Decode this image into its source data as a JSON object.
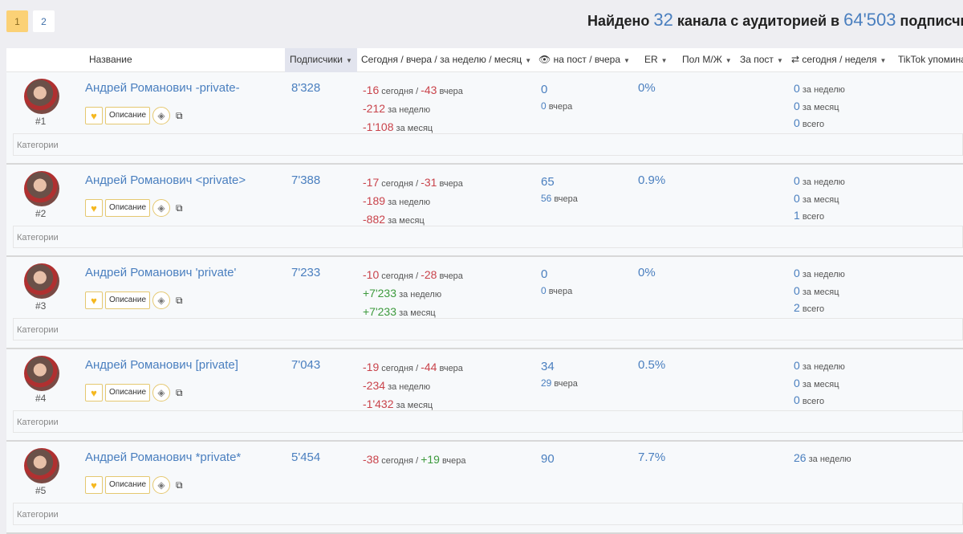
{
  "pagination": {
    "pages": [
      "1",
      "2"
    ],
    "active": "1"
  },
  "summary": {
    "prefix": "Найдено",
    "count": "32",
    "middle": "канала с аудиторией в",
    "audience": "64'503",
    "suffix": "подписчиков"
  },
  "columns": {
    "name": "Название",
    "subscribers": "Подписчики",
    "dynamics": "Сегодня / вчера / за неделю / месяц",
    "views": "на пост / вчера",
    "er": "ER",
    "gender": "Пол М/Ж",
    "per_post": "За пост",
    "reposts": "сегодня / неделя",
    "tiktok": "TikTok упомина"
  },
  "labels": {
    "description": "Описание",
    "categories": "Категории",
    "today": "сегодня /",
    "yesterday": "вчера",
    "week": "за неделю",
    "month": "за месяц",
    "total": "всего"
  },
  "rows": [
    {
      "rank": "#1",
      "name": "Андрей Романович -private-",
      "subs": "8'328",
      "today": "-16",
      "yest": "-43",
      "week": "-212",
      "month": "-1'108",
      "vpost": "0",
      "vyest": "0",
      "er": "0%",
      "r_week": "0",
      "r_month": "0",
      "r_total": "0"
    },
    {
      "rank": "#2",
      "name": "Андрей Романович <private>",
      "subs": "7'388",
      "today": "-17",
      "yest": "-31",
      "week": "-189",
      "month": "-882",
      "vpost": "65",
      "vyest": "56",
      "er": "0.9%",
      "r_week": "0",
      "r_month": "0",
      "r_total": "1"
    },
    {
      "rank": "#3",
      "name": "Андрей Романович 'private'",
      "subs": "7'233",
      "today": "-10",
      "yest": "-28",
      "week": "+7'233",
      "month": "+7'233",
      "vpost": "0",
      "vyest": "0",
      "er": "0%",
      "r_week": "0",
      "r_month": "0",
      "r_total": "2"
    },
    {
      "rank": "#4",
      "name": "Андрей Романович [private]",
      "subs": "7'043",
      "today": "-19",
      "yest": "-44",
      "week": "-234",
      "month": "-1'432",
      "vpost": "34",
      "vyest": "29",
      "er": "0.5%",
      "r_week": "0",
      "r_month": "0",
      "r_total": "0"
    },
    {
      "rank": "#5",
      "name": "Андрей Романович *private*",
      "subs": "5'454",
      "today": "-38",
      "yest": "+19",
      "week": "",
      "month": "",
      "vpost": "90",
      "vyest": "",
      "er": "7.7%",
      "r_week": "26",
      "r_month": "",
      "r_total": ""
    }
  ]
}
